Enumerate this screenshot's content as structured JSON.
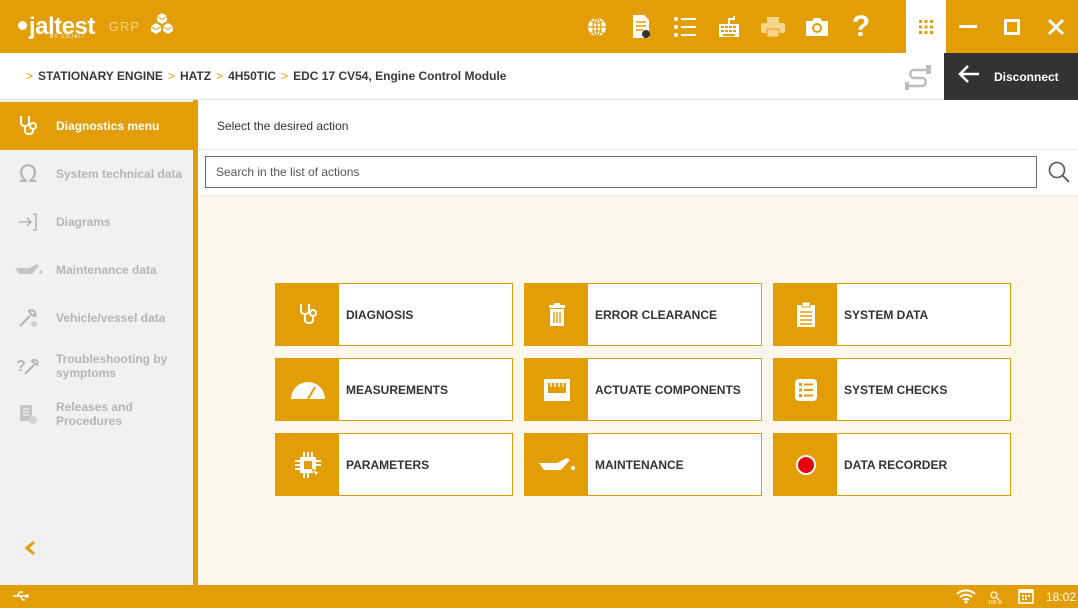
{
  "app": {
    "logo_text": "jaltest",
    "logo_sub": "BY COJALI",
    "brand_tag": "GRP"
  },
  "toolbar": {
    "icons": [
      "globe-icon",
      "document-icon",
      "list-icon",
      "keyboard-icon",
      "printer-icon",
      "camera-icon",
      "help-icon"
    ],
    "apps_icon": "apps-grid-icon",
    "window_controls": [
      "minimize-icon",
      "maximize-icon",
      "close-icon"
    ]
  },
  "breadcrumb": {
    "items": [
      "STATIONARY ENGINE",
      "HATZ",
      "4H50TIC",
      "EDC 17 CV54, Engine Control Module"
    ]
  },
  "disconnect": {
    "label": "Disconnect"
  },
  "sidebar": {
    "items": [
      {
        "label": "Diagnostics menu",
        "icon": "stethoscope-icon",
        "active": true
      },
      {
        "label": "System technical data",
        "icon": "ohm-icon",
        "active": false
      },
      {
        "label": "Diagrams",
        "icon": "diagram-icon",
        "active": false
      },
      {
        "label": "Maintenance data",
        "icon": "oil-can-icon",
        "active": false
      },
      {
        "label": "Vehicle/vessel data",
        "icon": "wrench-icon",
        "active": false
      },
      {
        "label": "Troubleshooting by symptoms",
        "icon": "troubleshoot-icon",
        "active": false
      },
      {
        "label": "Releases and Procedures",
        "icon": "releases-icon",
        "active": false
      }
    ]
  },
  "main": {
    "prompt": "Select the desired action",
    "search_placeholder": "Search in the list of actions",
    "actions": [
      {
        "label": "DIAGNOSIS",
        "icon": "stethoscope-icon"
      },
      {
        "label": "ERROR CLEARANCE",
        "icon": "trash-icon"
      },
      {
        "label": "SYSTEM DATA",
        "icon": "clipboard-icon"
      },
      {
        "label": "MEASUREMENTS",
        "icon": "gauge-icon"
      },
      {
        "label": "ACTUATE COMPONENTS",
        "icon": "connector-icon"
      },
      {
        "label": "SYSTEM CHECKS",
        "icon": "checklist-icon"
      },
      {
        "label": "PARAMETERS",
        "icon": "chip-icon"
      },
      {
        "label": "MAINTENANCE",
        "icon": "oil-can-icon"
      },
      {
        "label": "DATA RECORDER",
        "icon": "record-icon"
      }
    ]
  },
  "statusbar": {
    "zoom": "100 %",
    "time": "18:02"
  },
  "colors": {
    "accent": "#e39e06",
    "dark": "#333333",
    "record": "#e3000f"
  }
}
